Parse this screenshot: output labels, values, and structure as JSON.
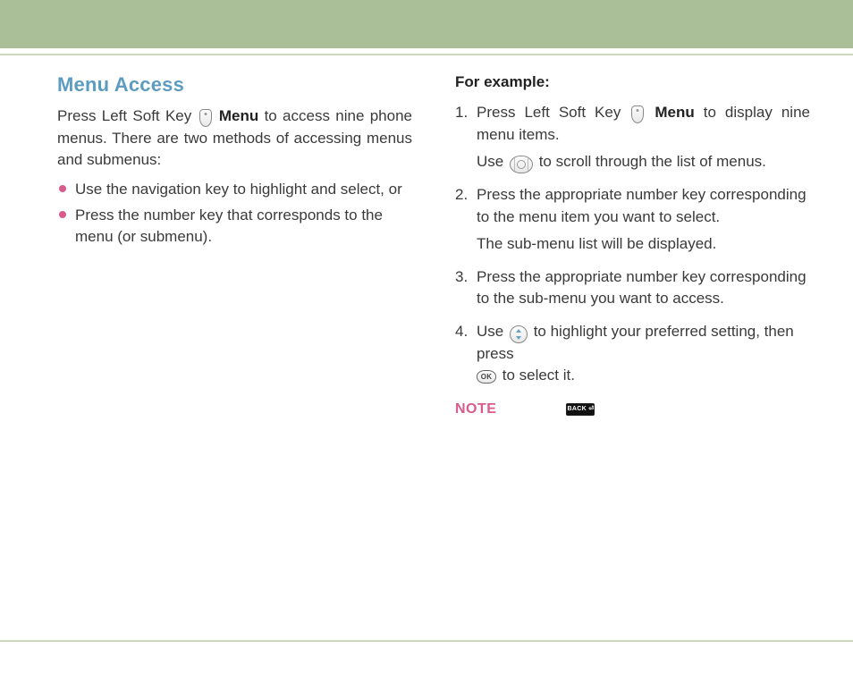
{
  "left": {
    "title": "Menu Access",
    "intro_before_icon": "Press Left Soft Key ",
    "intro_bold": " Menu",
    "intro_after_bold": " to access nine phone menus. There are two methods of accessing menus and submenus:",
    "bullets": [
      "Use the navigation key to highlight and select, or",
      "Press the number key that corresponds to the menu (or submenu)."
    ]
  },
  "right": {
    "subhead": "For example:",
    "step1_before_icon": "Press Left Soft Key ",
    "step1_bold": " Menu",
    "step1_after_bold": " to display nine menu items.",
    "step1_sub_before": "Use ",
    "step1_sub_after": " to scroll through the list of menus.",
    "step2_a": "Press the appropriate number key corresponding to the menu item you want to select.",
    "step2_b": "The sub-menu list will be displayed.",
    "step3": "Press the appropriate number key corresponding to the sub-menu you want to access.",
    "step4_before": "Use ",
    "step4_mid": " to highlight your preferred setting, then press ",
    "step4_after": " to select it.",
    "note_label": "NOTE",
    "ok_text": "OK",
    "back_text": "BACK ⏎"
  }
}
